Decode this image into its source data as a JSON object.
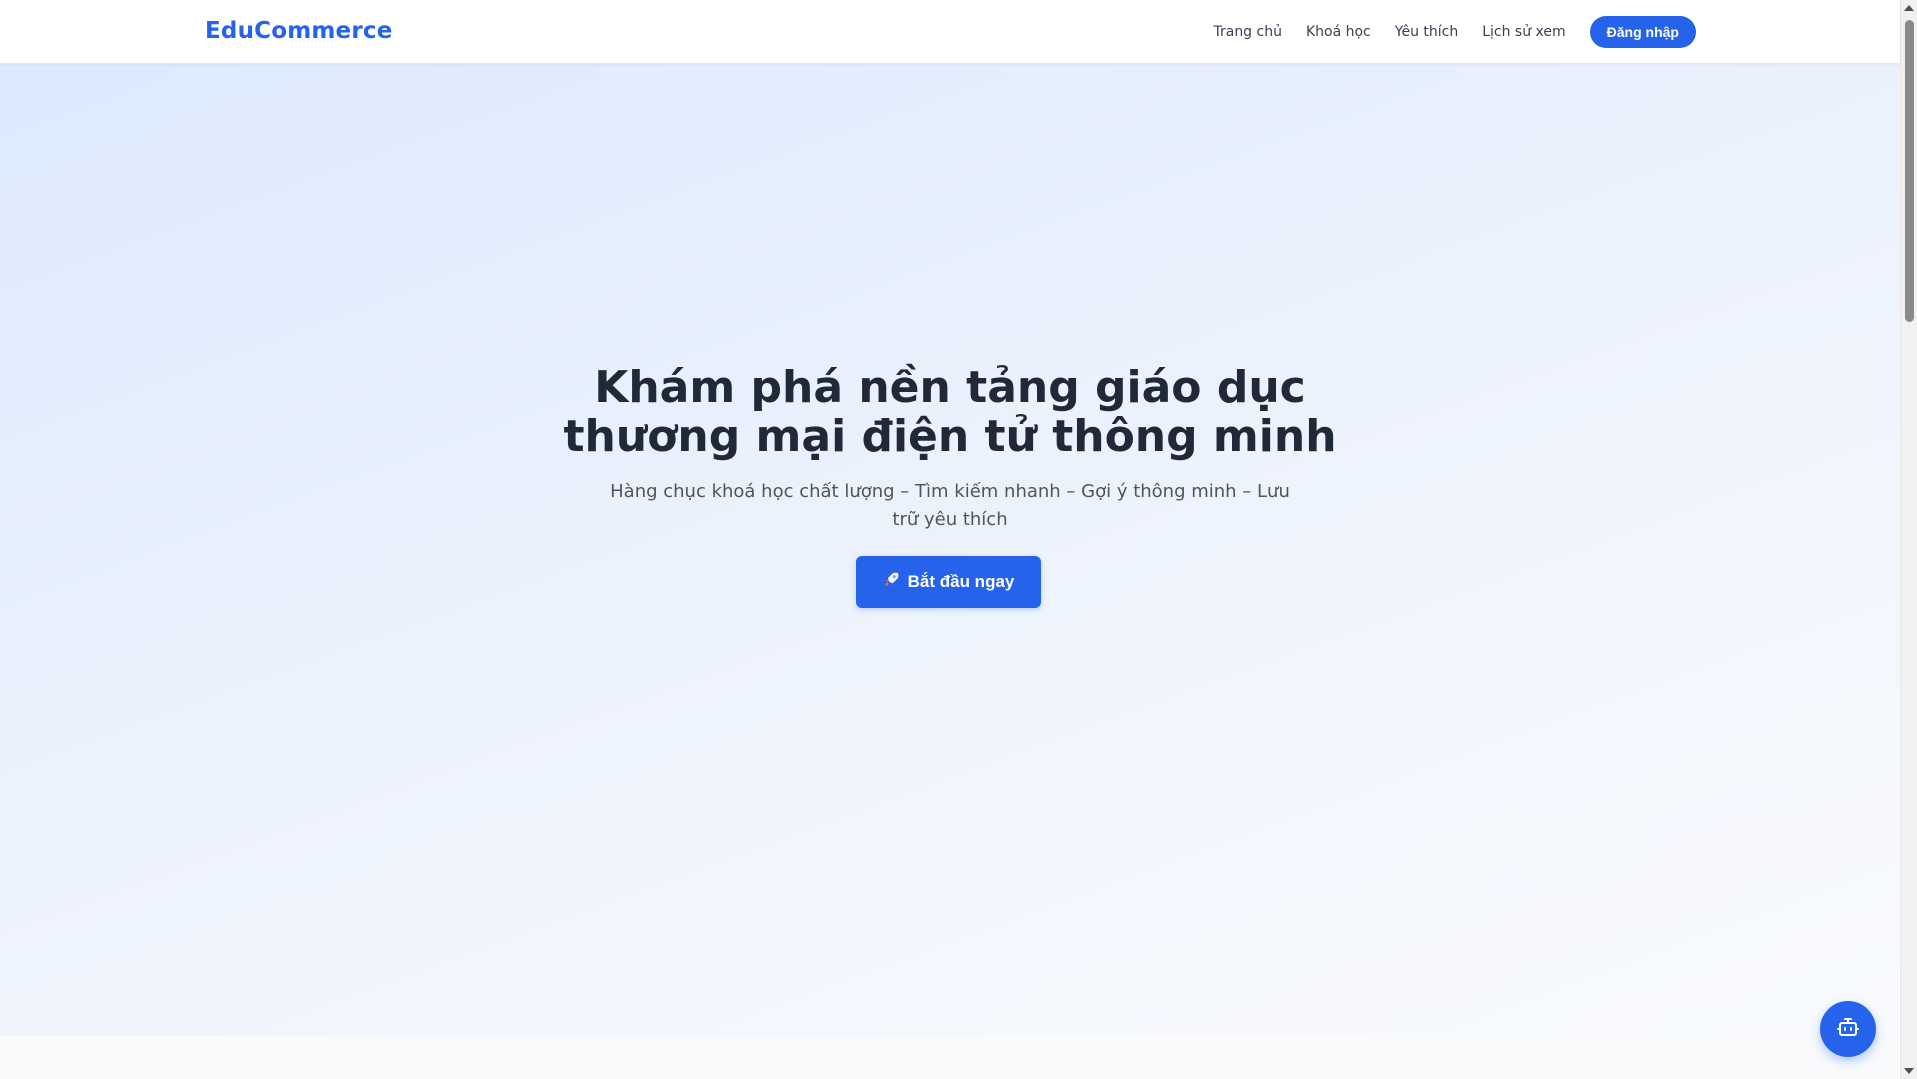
{
  "header": {
    "brand": "EduCommerce",
    "nav": [
      {
        "label": "Trang chủ"
      },
      {
        "label": "Khoá học"
      },
      {
        "label": "Yêu thích"
      },
      {
        "label": "Lịch sử xem"
      }
    ],
    "login_label": "Đăng nhập"
  },
  "hero": {
    "title": "Khám phá nền tảng giáo dục thương mại điện tử thông minh",
    "subtitle": "Hàng chục khoá học chất lượng – Tìm kiếm nhanh – Gợi ý thông minh – Lưu trữ yêu thích",
    "cta_label": "Bắt đầu ngay",
    "cta_icon": "rocket-icon"
  },
  "chat_fab": {
    "icon": "robot-icon"
  },
  "colors": {
    "primary": "#2563eb",
    "text_dark": "#1f2937",
    "text_muted": "#4b5563",
    "hero_bg_start": "#dce9fd",
    "hero_bg_end": "#f8fafe"
  }
}
